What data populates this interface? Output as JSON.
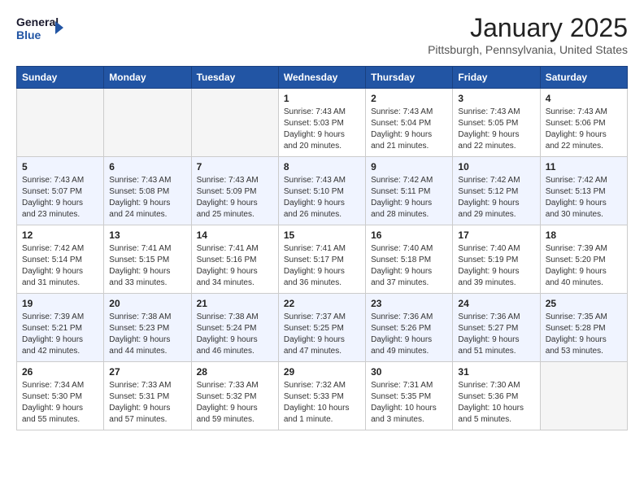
{
  "logo": {
    "line1": "General",
    "line2": "Blue"
  },
  "title": "January 2025",
  "location": "Pittsburgh, Pennsylvania, United States",
  "days_of_week": [
    "Sunday",
    "Monday",
    "Tuesday",
    "Wednesday",
    "Thursday",
    "Friday",
    "Saturday"
  ],
  "weeks": [
    [
      {
        "num": "",
        "info": ""
      },
      {
        "num": "",
        "info": ""
      },
      {
        "num": "",
        "info": ""
      },
      {
        "num": "1",
        "info": "Sunrise: 7:43 AM\nSunset: 5:03 PM\nDaylight: 9 hours\nand 20 minutes."
      },
      {
        "num": "2",
        "info": "Sunrise: 7:43 AM\nSunset: 5:04 PM\nDaylight: 9 hours\nand 21 minutes."
      },
      {
        "num": "3",
        "info": "Sunrise: 7:43 AM\nSunset: 5:05 PM\nDaylight: 9 hours\nand 22 minutes."
      },
      {
        "num": "4",
        "info": "Sunrise: 7:43 AM\nSunset: 5:06 PM\nDaylight: 9 hours\nand 22 minutes."
      }
    ],
    [
      {
        "num": "5",
        "info": "Sunrise: 7:43 AM\nSunset: 5:07 PM\nDaylight: 9 hours\nand 23 minutes."
      },
      {
        "num": "6",
        "info": "Sunrise: 7:43 AM\nSunset: 5:08 PM\nDaylight: 9 hours\nand 24 minutes."
      },
      {
        "num": "7",
        "info": "Sunrise: 7:43 AM\nSunset: 5:09 PM\nDaylight: 9 hours\nand 25 minutes."
      },
      {
        "num": "8",
        "info": "Sunrise: 7:43 AM\nSunset: 5:10 PM\nDaylight: 9 hours\nand 26 minutes."
      },
      {
        "num": "9",
        "info": "Sunrise: 7:42 AM\nSunset: 5:11 PM\nDaylight: 9 hours\nand 28 minutes."
      },
      {
        "num": "10",
        "info": "Sunrise: 7:42 AM\nSunset: 5:12 PM\nDaylight: 9 hours\nand 29 minutes."
      },
      {
        "num": "11",
        "info": "Sunrise: 7:42 AM\nSunset: 5:13 PM\nDaylight: 9 hours\nand 30 minutes."
      }
    ],
    [
      {
        "num": "12",
        "info": "Sunrise: 7:42 AM\nSunset: 5:14 PM\nDaylight: 9 hours\nand 31 minutes."
      },
      {
        "num": "13",
        "info": "Sunrise: 7:41 AM\nSunset: 5:15 PM\nDaylight: 9 hours\nand 33 minutes."
      },
      {
        "num": "14",
        "info": "Sunrise: 7:41 AM\nSunset: 5:16 PM\nDaylight: 9 hours\nand 34 minutes."
      },
      {
        "num": "15",
        "info": "Sunrise: 7:41 AM\nSunset: 5:17 PM\nDaylight: 9 hours\nand 36 minutes."
      },
      {
        "num": "16",
        "info": "Sunrise: 7:40 AM\nSunset: 5:18 PM\nDaylight: 9 hours\nand 37 minutes."
      },
      {
        "num": "17",
        "info": "Sunrise: 7:40 AM\nSunset: 5:19 PM\nDaylight: 9 hours\nand 39 minutes."
      },
      {
        "num": "18",
        "info": "Sunrise: 7:39 AM\nSunset: 5:20 PM\nDaylight: 9 hours\nand 40 minutes."
      }
    ],
    [
      {
        "num": "19",
        "info": "Sunrise: 7:39 AM\nSunset: 5:21 PM\nDaylight: 9 hours\nand 42 minutes."
      },
      {
        "num": "20",
        "info": "Sunrise: 7:38 AM\nSunset: 5:23 PM\nDaylight: 9 hours\nand 44 minutes."
      },
      {
        "num": "21",
        "info": "Sunrise: 7:38 AM\nSunset: 5:24 PM\nDaylight: 9 hours\nand 46 minutes."
      },
      {
        "num": "22",
        "info": "Sunrise: 7:37 AM\nSunset: 5:25 PM\nDaylight: 9 hours\nand 47 minutes."
      },
      {
        "num": "23",
        "info": "Sunrise: 7:36 AM\nSunset: 5:26 PM\nDaylight: 9 hours\nand 49 minutes."
      },
      {
        "num": "24",
        "info": "Sunrise: 7:36 AM\nSunset: 5:27 PM\nDaylight: 9 hours\nand 51 minutes."
      },
      {
        "num": "25",
        "info": "Sunrise: 7:35 AM\nSunset: 5:28 PM\nDaylight: 9 hours\nand 53 minutes."
      }
    ],
    [
      {
        "num": "26",
        "info": "Sunrise: 7:34 AM\nSunset: 5:30 PM\nDaylight: 9 hours\nand 55 minutes."
      },
      {
        "num": "27",
        "info": "Sunrise: 7:33 AM\nSunset: 5:31 PM\nDaylight: 9 hours\nand 57 minutes."
      },
      {
        "num": "28",
        "info": "Sunrise: 7:33 AM\nSunset: 5:32 PM\nDaylight: 9 hours\nand 59 minutes."
      },
      {
        "num": "29",
        "info": "Sunrise: 7:32 AM\nSunset: 5:33 PM\nDaylight: 10 hours\nand 1 minute."
      },
      {
        "num": "30",
        "info": "Sunrise: 7:31 AM\nSunset: 5:35 PM\nDaylight: 10 hours\nand 3 minutes."
      },
      {
        "num": "31",
        "info": "Sunrise: 7:30 AM\nSunset: 5:36 PM\nDaylight: 10 hours\nand 5 minutes."
      },
      {
        "num": "",
        "info": ""
      }
    ]
  ]
}
